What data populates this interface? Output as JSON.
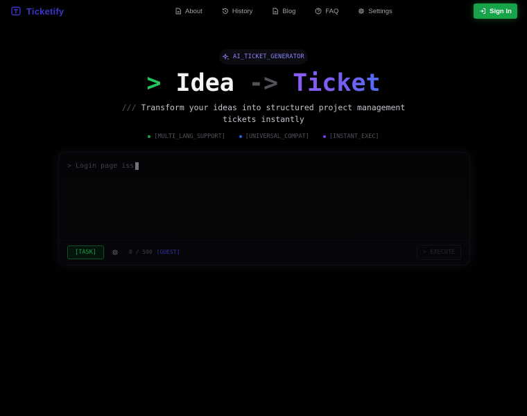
{
  "header": {
    "logo_text": "Ticketify",
    "nav": [
      {
        "label": "About",
        "icon": "document-icon"
      },
      {
        "label": "History",
        "icon": "history-icon"
      },
      {
        "label": "Blog",
        "icon": "document-icon"
      },
      {
        "label": "FAQ",
        "icon": "help-circle-icon"
      },
      {
        "label": "Settings",
        "icon": "gear-icon"
      }
    ],
    "signin_label": "Sign In"
  },
  "hero": {
    "badge": "AI_TICKET_GENERATOR",
    "title_prompt": ">",
    "title_idea": "Idea",
    "title_arrow": "->",
    "title_ticket": "Ticket",
    "subtitle_prefix": "///",
    "subtitle": "Transform your ideas into structured project management tickets instantly",
    "features": [
      {
        "label": "[MULTI_LANG_SUPPORT]",
        "color": "#16a34a"
      },
      {
        "label": "[UNIVERSAL_COMPAT]",
        "color": "#2563eb"
      },
      {
        "label": "[INSTANT_EXEC]",
        "color": "#7c3aed"
      }
    ]
  },
  "input": {
    "placeholder": "> Login page iss",
    "task_label": "[TASK]",
    "count": "0 / 500",
    "mode": "[GUEST]",
    "execute_label": "> EXECUTE"
  },
  "colors": {
    "brand": "#3b35c9",
    "accent_green": "#16a34a",
    "accent_purple": "#8b5cf6"
  }
}
